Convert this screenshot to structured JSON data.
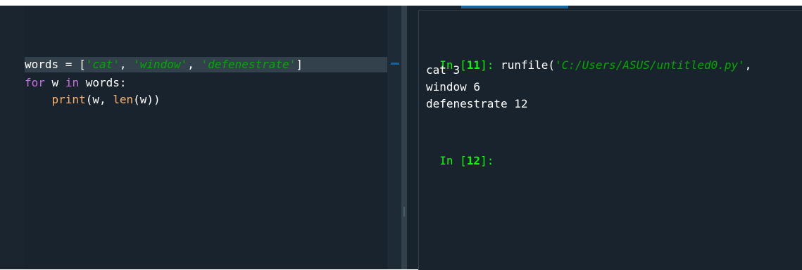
{
  "editor": {
    "lines": [
      {
        "tokens": [
          {
            "text": "words = [",
            "kind": "plain"
          },
          {
            "text": "'cat'",
            "kind": "str"
          },
          {
            "text": ", ",
            "kind": "plain"
          },
          {
            "text": "'window'",
            "kind": "str"
          },
          {
            "text": ", ",
            "kind": "plain"
          },
          {
            "text": "'defenestrate'",
            "kind": "str"
          },
          {
            "text": "]",
            "kind": "plain"
          }
        ]
      },
      {
        "tokens": [
          {
            "text": "for",
            "kind": "kw"
          },
          {
            "text": " w ",
            "kind": "plain"
          },
          {
            "text": "in",
            "kind": "kw"
          },
          {
            "text": " words:",
            "kind": "plain"
          }
        ]
      },
      {
        "tokens": [
          {
            "text": "    ",
            "kind": "plain"
          },
          {
            "text": "print",
            "kind": "bi"
          },
          {
            "text": "(w, ",
            "kind": "plain"
          },
          {
            "text": "len",
            "kind": "bi"
          },
          {
            "text": "(w))",
            "kind": "plain"
          }
        ]
      }
    ]
  },
  "console": {
    "prompt1": {
      "label": "In [",
      "number": "11",
      "close": "]:"
    },
    "command": {
      "prefix": " runfile(",
      "path": "'C:/Users/ASUS/untitled0.py'",
      "suffix": ","
    },
    "output": [
      "cat 3",
      "window 6",
      "defenestrate 12"
    ],
    "prompt2": {
      "label": "In [",
      "number": "12",
      "close": "]:"
    }
  },
  "colors": {
    "background": "#19232d",
    "current_line": "#32414b",
    "keyword": "#c670e0",
    "string": "#00aa00",
    "builtin": "#fab16c",
    "prompt": "#00ff00",
    "accent": "#1464a0"
  }
}
